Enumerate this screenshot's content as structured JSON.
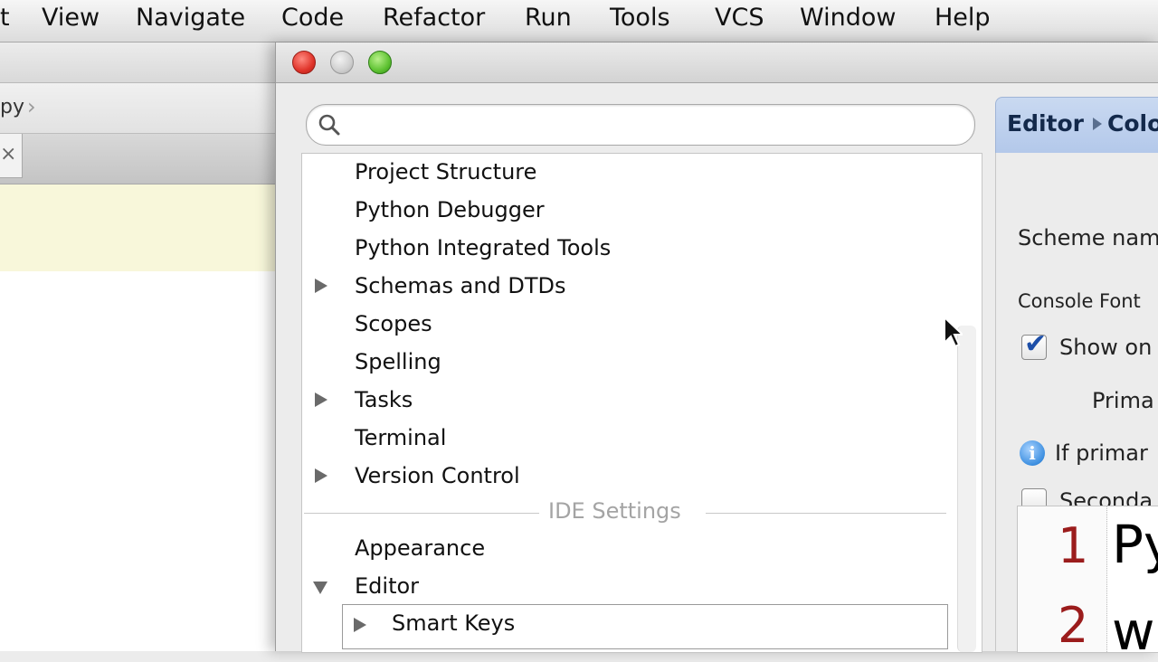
{
  "menu_bar": {
    "items": [
      "t",
      "View",
      "Navigate",
      "Code",
      "Refactor",
      "Run",
      "Tools",
      "VCS",
      "Window",
      "Help"
    ]
  },
  "background_window": {
    "breadcrumb_text": "py",
    "tab_close_glyph": "×"
  },
  "settings_dialog": {
    "search": {
      "value": "",
      "placeholder": ""
    },
    "tree": {
      "project_items": [
        {
          "label": "Project Structure",
          "expandable": false
        },
        {
          "label": "Python Debugger",
          "expandable": false
        },
        {
          "label": "Python Integrated Tools",
          "expandable": false
        },
        {
          "label": "Schemas and DTDs",
          "expandable": true
        },
        {
          "label": "Scopes",
          "expandable": false
        },
        {
          "label": "Spelling",
          "expandable": false
        },
        {
          "label": "Tasks",
          "expandable": true
        },
        {
          "label": "Terminal",
          "expandable": false
        },
        {
          "label": "Version Control",
          "expandable": true
        }
      ],
      "ide_section_title": "IDE Settings",
      "ide_items": [
        {
          "label": "Appearance",
          "expandable": false
        },
        {
          "label": "Editor",
          "expandable": true,
          "expanded": true
        }
      ],
      "editor_children": [
        {
          "label": "Smart Keys",
          "expandable": true,
          "selected": true
        }
      ]
    },
    "right_pane": {
      "breadcrumb": [
        "Editor",
        "Colo"
      ],
      "scheme_name_label": "Scheme nam",
      "console_font_label": "Console Font",
      "show_only_label": "Show on",
      "show_only_checked": true,
      "primary_label": "Prima",
      "info_text": "If primar",
      "secondary_label": "Seconda",
      "secondary_checked": false,
      "preview": {
        "line_numbers": [
          "1",
          "2"
        ],
        "code_lines": [
          "Py",
          "w"
        ]
      }
    }
  },
  "colors": {
    "accent_header": "#b3c8ea",
    "line_number_red": "#9b1c1c",
    "editor_highlight": "#f8f7da"
  }
}
